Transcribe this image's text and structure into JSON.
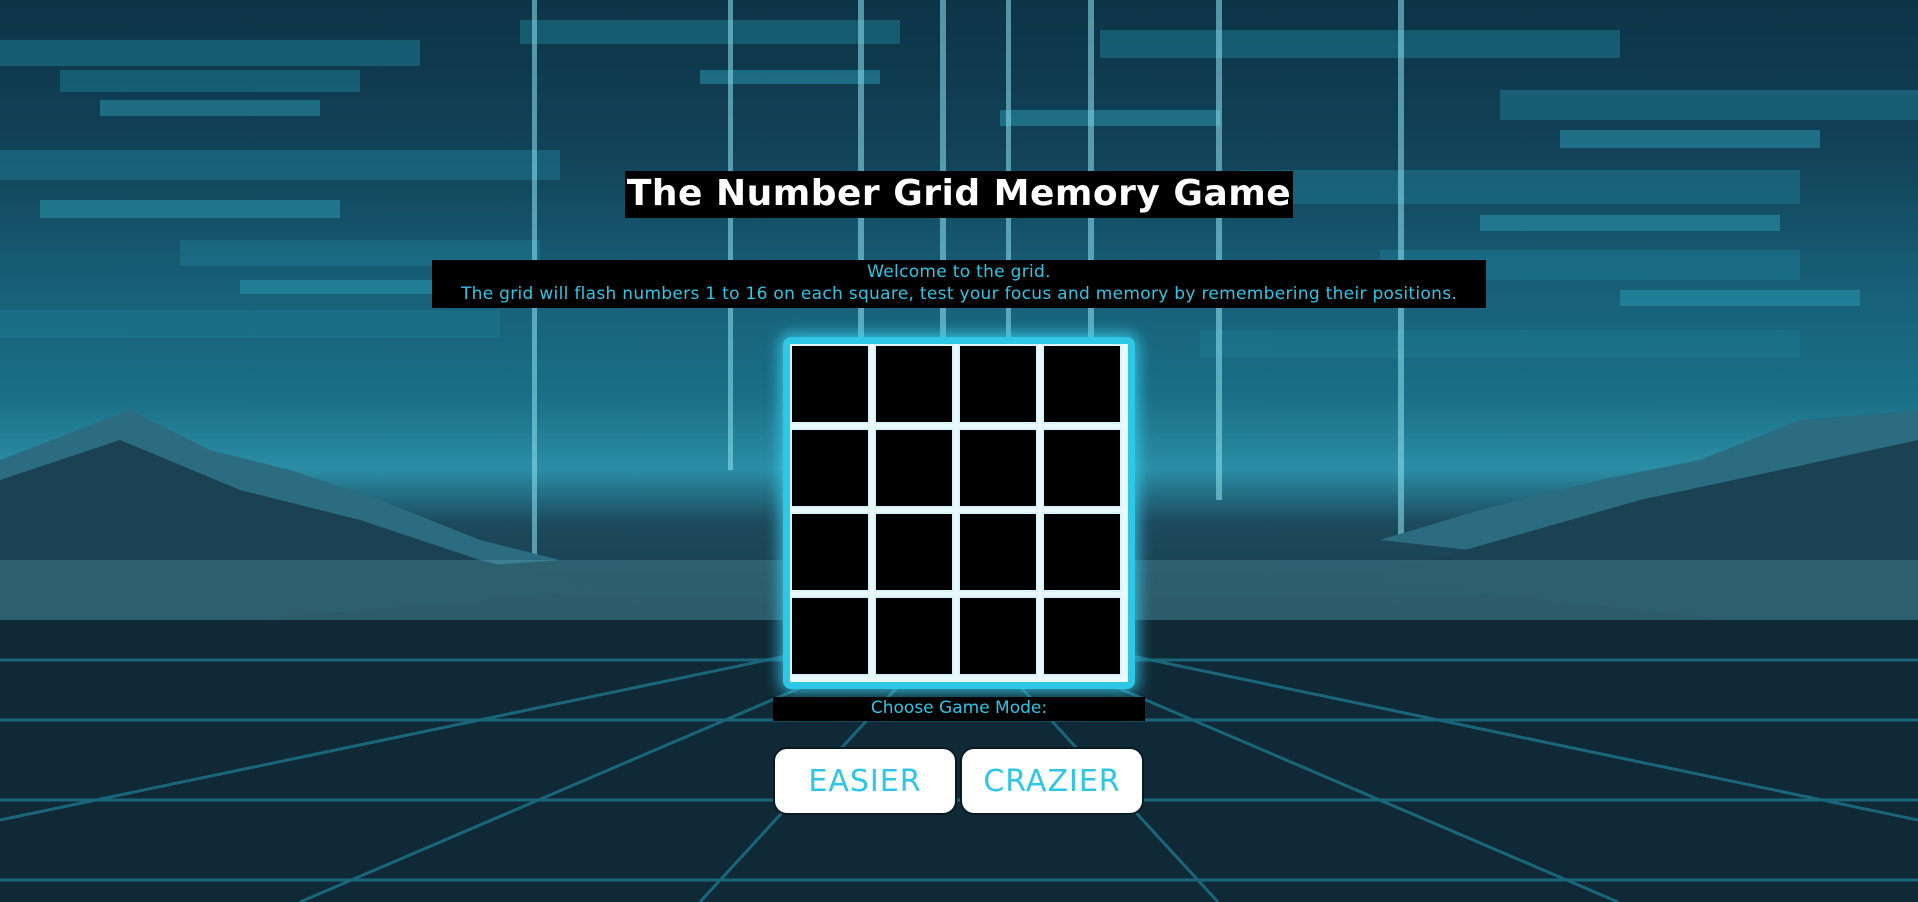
{
  "page": {
    "title": "The Number Grid Memory Game",
    "intro_line1": "Welcome to the grid.",
    "intro_line2": "The grid will flash numbers 1 to 16 on each square, test your focus and memory by remembering their positions."
  },
  "grid": {
    "rows": 4,
    "columns": 4,
    "cells": [
      "",
      "",
      "",
      "",
      "",
      "",
      "",
      "",
      "",
      "",
      "",
      "",
      "",
      "",
      "",
      ""
    ]
  },
  "mode": {
    "label": "Choose Game Mode:",
    "buttons": [
      "EASIER",
      "CRAZIER"
    ]
  },
  "colors": {
    "accent": "#2fc7e6",
    "title_text": "#ffffff",
    "cell_background": "#000000",
    "button_background": "#ffffff"
  }
}
